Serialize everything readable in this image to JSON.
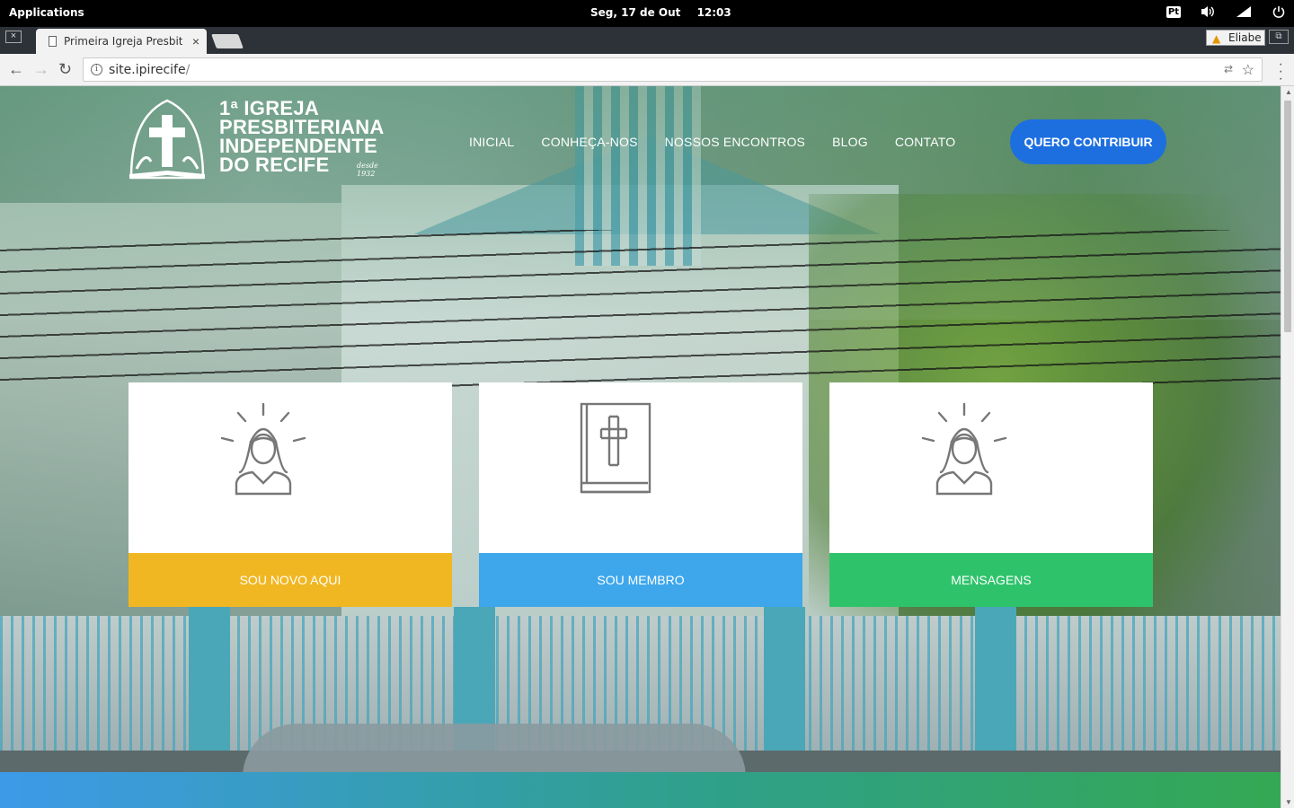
{
  "system": {
    "apps_label": "Applications",
    "date": "Seg, 17 de Out",
    "time": "12:03",
    "lang": "Pt"
  },
  "browser": {
    "tab_title": "Primeira Igreja Presbiteriana",
    "tab_close": "×",
    "profile_name": "Eliabe",
    "url_host": "site.ipirecife",
    "url_path": "/",
    "window_close": "×"
  },
  "site": {
    "logo_lines": [
      "1ª IGREJA",
      "PRESBITERIANA",
      "INDEPENDENTE",
      "DO RECIFE"
    ],
    "logo_since": "desde 1932",
    "nav": [
      "INICIAL",
      "CONHEÇA-NOS",
      "NOSSOS ENCONTROS",
      "BLOG",
      "CONTATO"
    ],
    "cta": "QUERO CONTRIBUIR",
    "cards": [
      {
        "label": "SOU NOVO AQUI",
        "color": "#f0b722",
        "icon": "person-light-icon"
      },
      {
        "label": "SOU MEMBRO",
        "color": "#3ea7ec",
        "icon": "bible-icon"
      },
      {
        "label": "MENSAGENS",
        "color": "#2ec36b",
        "icon": "person-light-icon"
      }
    ]
  },
  "colors": {
    "cta_blue": "#1d6fe0",
    "card_yellow": "#f0b722",
    "card_blue": "#3ea7ec",
    "card_green": "#2ec36b"
  }
}
